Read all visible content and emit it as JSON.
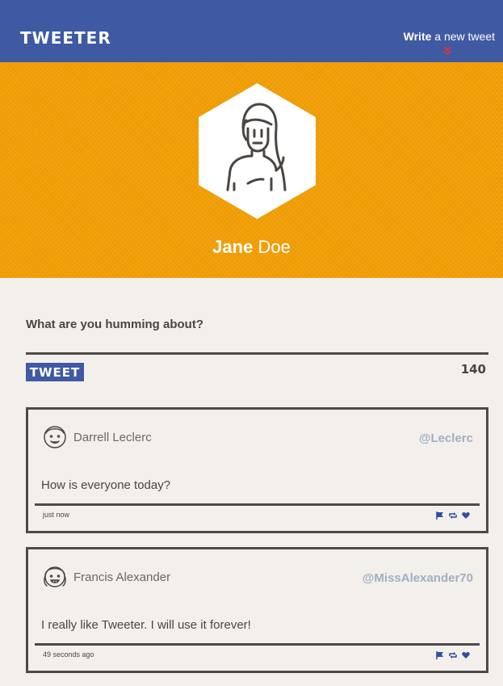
{
  "header": {
    "logo": "TWEETER",
    "compose_bold": "Write",
    "compose_rest": " a new tweet",
    "colors": {
      "bar": "#4059a3",
      "chevron": "#e0303c"
    }
  },
  "profile": {
    "first_name": "Jane",
    "last_name": " Doe",
    "colors": {
      "background": "#f29f05"
    }
  },
  "composer": {
    "label": "What are you humming about?",
    "input_value": "",
    "button_label": "TWEET",
    "char_count": "140"
  },
  "tweets": [
    {
      "author": "Darrell Leclerc",
      "handle": "@Leclerc",
      "text": "How is everyone today?",
      "time": "just now",
      "avatar_icon": "male-avatar-icon"
    },
    {
      "author": "Francis Alexander",
      "handle": "@MissAlexander70",
      "text": "I really like Tweeter. I will use it forever!",
      "time": "49 seconds ago",
      "avatar_icon": "female-avatar-icon"
    }
  ],
  "icons": {
    "flag": "flag-icon",
    "retweet": "retweet-icon",
    "like": "heart-icon",
    "accent": "#2f4ea0"
  }
}
